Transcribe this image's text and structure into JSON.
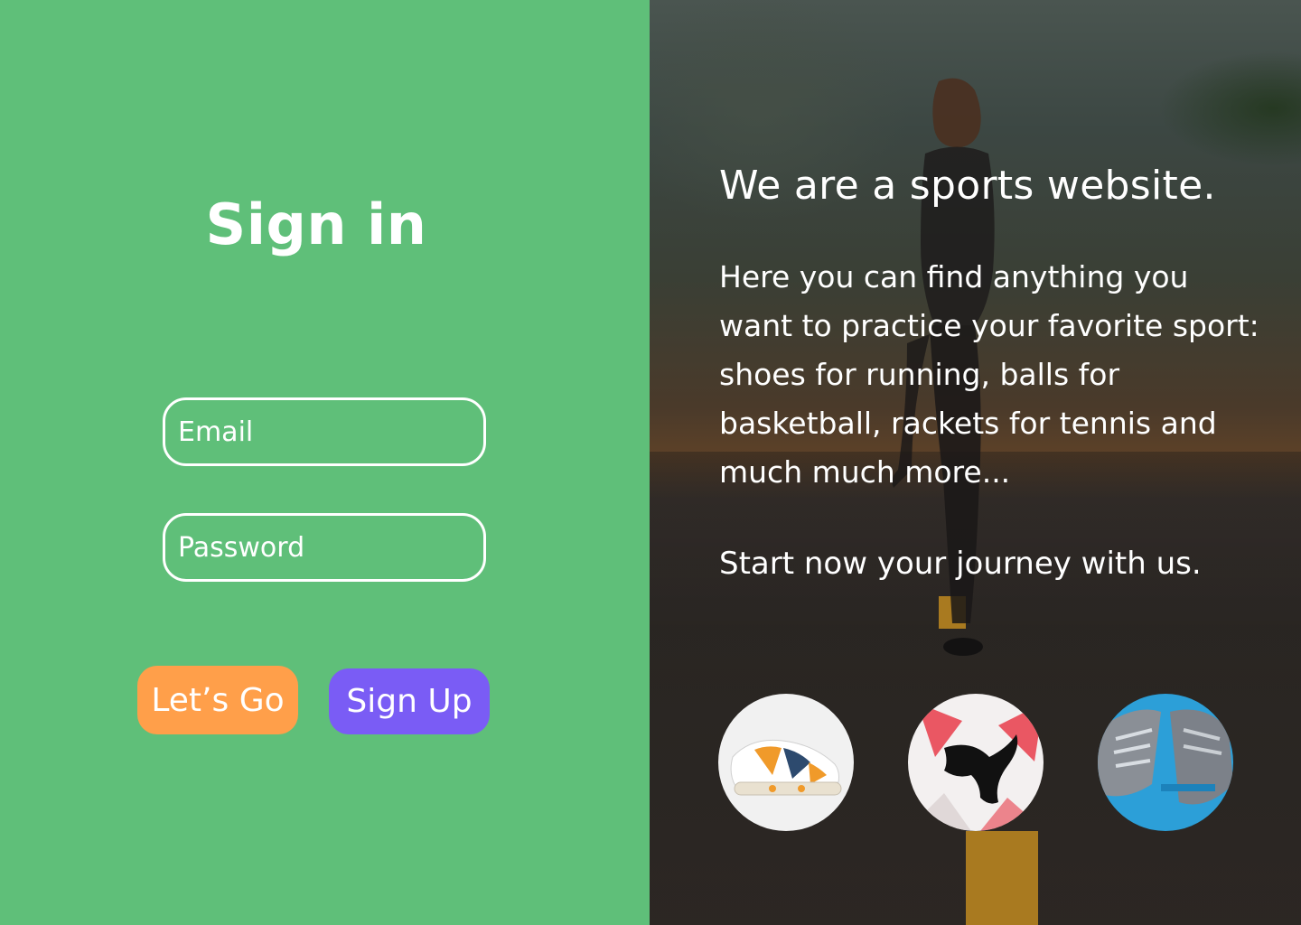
{
  "signin": {
    "title": "Sign in",
    "email_placeholder": "Email",
    "password_placeholder": "Password",
    "letsgo_label": "Let’s Go",
    "signup_label": "Sign Up"
  },
  "promo": {
    "headline": "We are a sports website.",
    "description": "Here you can find anything you want to practice your favorite sport: shoes for running, balls for basketball, rackets for tennis and much much more...",
    "cta": "Start now your journey with us."
  },
  "icons": {
    "thumb_1": "sneaker-icon",
    "thumb_2": "ball-icon",
    "thumb_3": "running-shoes-icon"
  },
  "colors": {
    "left_panel_bg": "#5fbf79",
    "letsgo_button": "#ff9f4a",
    "signup_button": "#7a5cf5",
    "text": "#ffffff"
  }
}
